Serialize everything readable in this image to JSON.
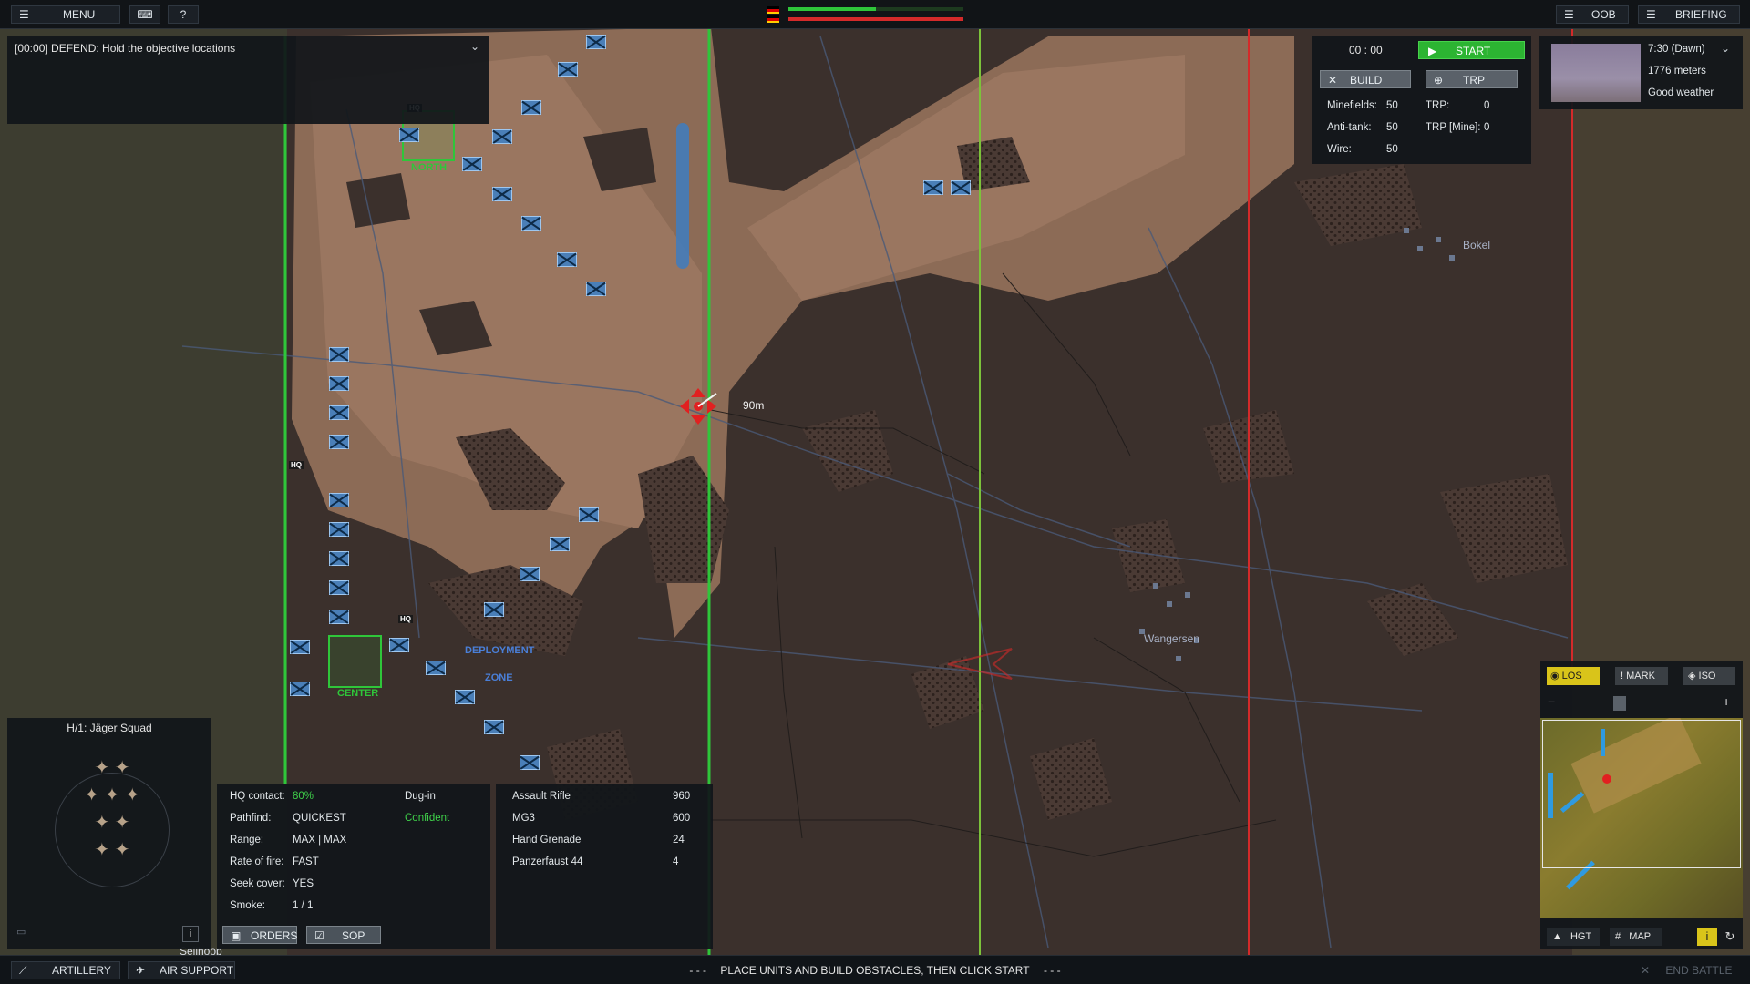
{
  "topbar": {
    "menu_label": "MENU",
    "help_label": "?",
    "oob_label": "OOB",
    "briefing_label": "BRIEFING"
  },
  "objective": {
    "text": "[00:00] DEFEND: Hold the objective locations"
  },
  "timer": {
    "time": "00 : 00",
    "start_label": "START",
    "build_label": "BUILD",
    "trp_label": "TRP"
  },
  "resources": [
    {
      "label": "Minefields:",
      "value": "50"
    },
    {
      "label": "Anti-tank:",
      "value": "50"
    },
    {
      "label": "Wire:",
      "value": "50"
    }
  ],
  "trp_resources": [
    {
      "label": "TRP:",
      "value": "0"
    },
    {
      "label": "TRP [Mine]:",
      "value": "0"
    }
  ],
  "weather": {
    "time": "7:30 (Dawn)",
    "visibility": "1776 meters",
    "condition": "Good weather"
  },
  "map_labels": {
    "north": "NORTH",
    "center": "CENTER",
    "deployment": "DEPLOYMENT",
    "zone": "ZONE",
    "distance": "90m",
    "bokel": "Bokel",
    "wangersen": "Wangersen",
    "sellhoop": "Sellhoop",
    "hq": "HQ"
  },
  "minimap": {
    "los_label": "LOS",
    "mark_label": "MARK",
    "iso_label": "ISO",
    "hgt_label": "HGT",
    "map_label": "MAP",
    "zoom_out": "−",
    "zoom_in": "+"
  },
  "unit_panel": {
    "title": "H/1: Jäger Squad",
    "status_rows": [
      {
        "label": "HQ contact:",
        "value": "80%"
      },
      {
        "label": "Pathfind:",
        "value": "QUICKEST"
      },
      {
        "label": "Range:",
        "value": "MAX | MAX"
      },
      {
        "label": "Rate of fire:",
        "value": "FAST"
      },
      {
        "label": "Seek cover:",
        "value": "YES"
      },
      {
        "label": "Smoke:",
        "value": "1 / 1"
      }
    ],
    "state": "Dug-in",
    "morale": "Confident",
    "weapons": [
      {
        "name": "Assault Rifle",
        "ammo": "960"
      },
      {
        "name": "MG3",
        "ammo": "600"
      },
      {
        "name": "Hand Grenade",
        "ammo": "24"
      },
      {
        "name": "Panzerfaust 44",
        "ammo": "4"
      }
    ],
    "orders_label": "ORDERS",
    "sop_label": "SOP",
    "info_label": "i"
  },
  "bottombar": {
    "artillery_label": "ARTILLERY",
    "air_support_label": "AIR SUPPORT",
    "message": "PLACE UNITS AND BUILD OBSTACLES, THEN CLICK START",
    "message_dashes_left": "- - -",
    "message_dashes_right": "- - -",
    "end_battle_label": "END BATTLE"
  },
  "colors": {
    "friendly": "#4a7fb8",
    "enemy_line": "#d42a2a",
    "deploy_line": "#2fc63a",
    "accent_green": "#2cb432",
    "highlight_yellow": "#d9c41a"
  },
  "health_bars": {
    "friendly_fraction": 0.5,
    "enemy_fraction": 1.0
  }
}
